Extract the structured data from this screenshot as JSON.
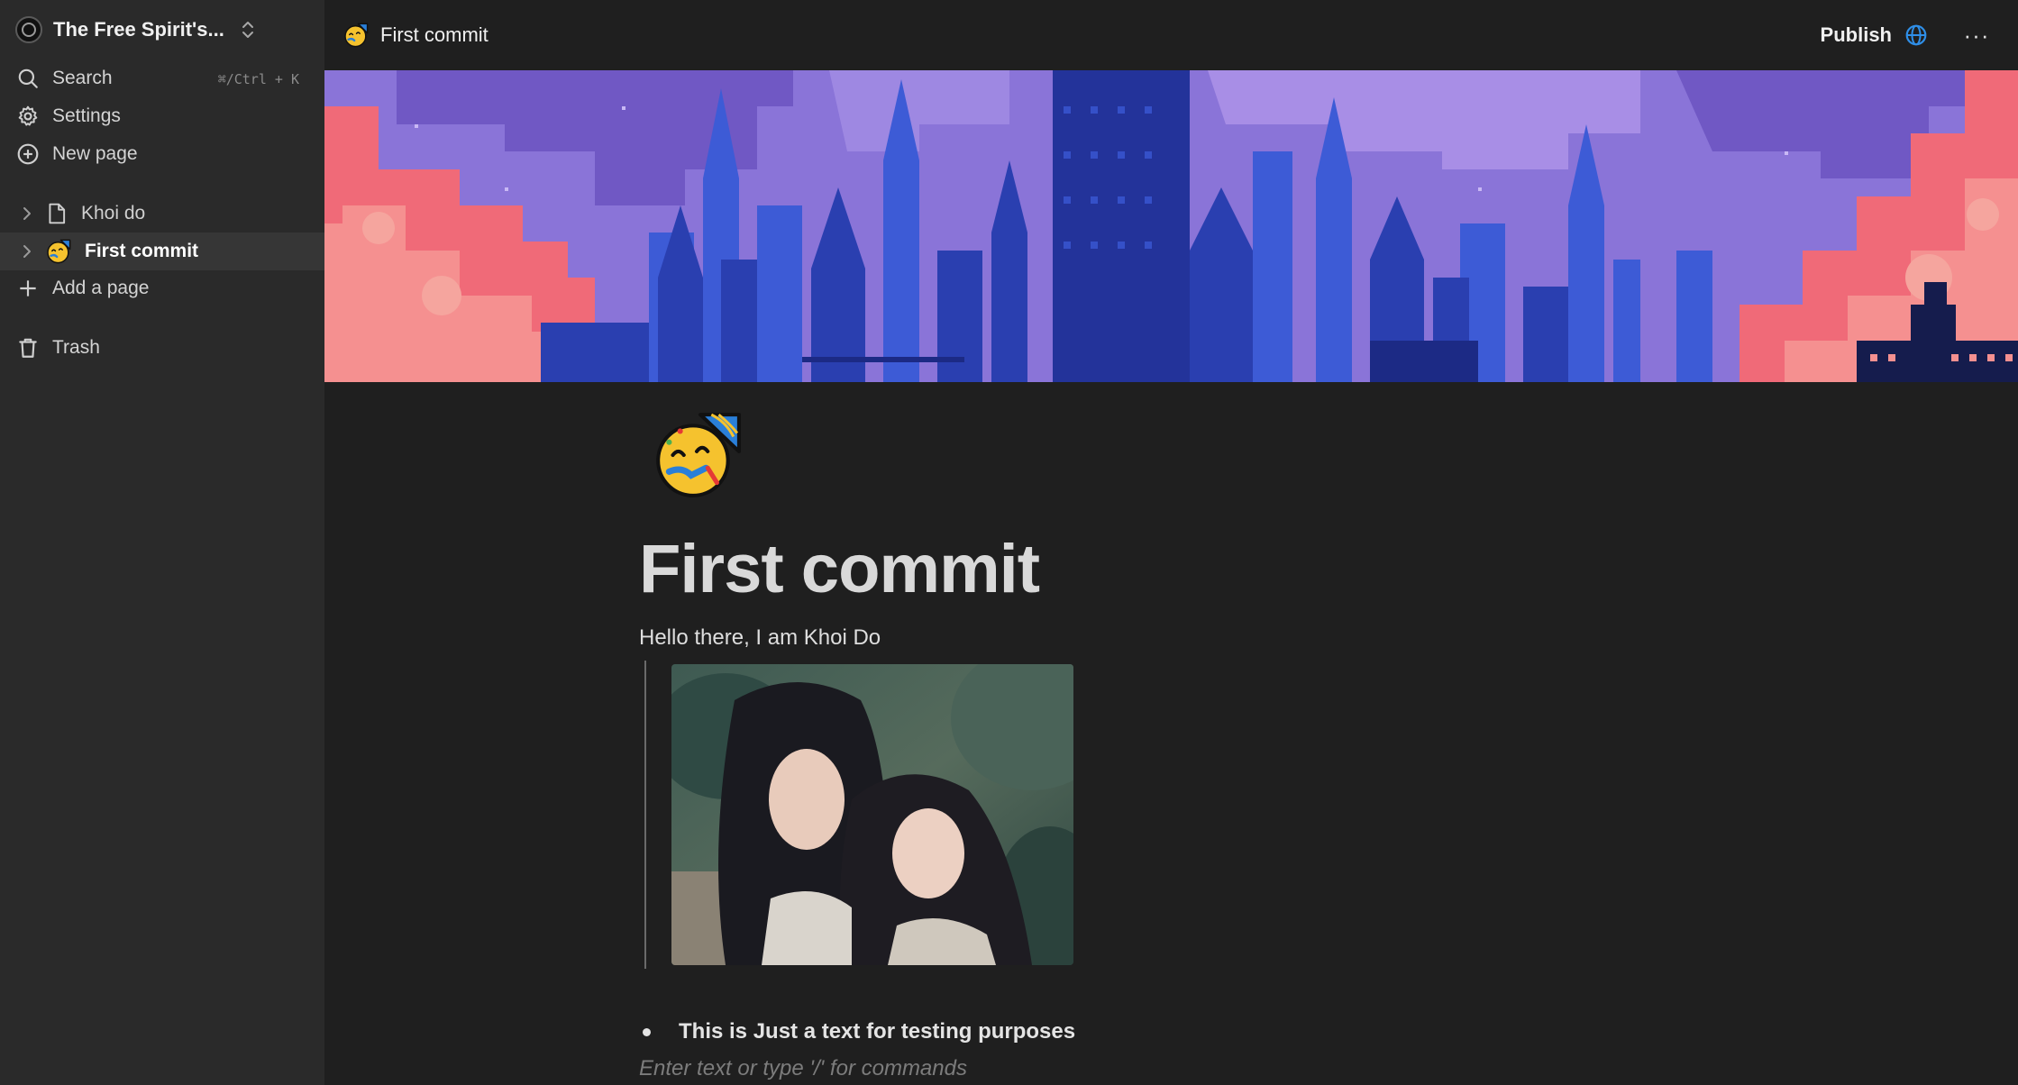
{
  "workspace": {
    "name": "The Free Spirit's...",
    "logo_icon": "workspace-logo-icon"
  },
  "sidebar": {
    "search_label": "Search",
    "search_shortcut": "⌘/Ctrl + K",
    "settings_label": "Settings",
    "new_page_label": "New page",
    "pages": [
      {
        "label": "Khoi do",
        "icon": "page-icon",
        "active": false
      },
      {
        "label": "First commit",
        "icon": "partying-face-emoji",
        "active": true
      }
    ],
    "add_page_label": "Add a page",
    "trash_label": "Trash"
  },
  "topbar": {
    "breadcrumb": "First commit",
    "publish_label": "Publish",
    "more_label": "···"
  },
  "page": {
    "title": "First commit",
    "paragraph": "Hello there, I am Khoi Do",
    "bullet": "This is Just a text for testing purposes",
    "placeholder": "Enter text or type '/' for commands"
  },
  "colors": {
    "background": "#1f1f1f",
    "sidebar": "#2a2a2a",
    "active_row": "#363636",
    "accent_globe": "#2f8fe8",
    "cover_sky": "#8a74d8",
    "cover_clouds": "#f06a78",
    "cover_buildings": "#2f48c4"
  }
}
